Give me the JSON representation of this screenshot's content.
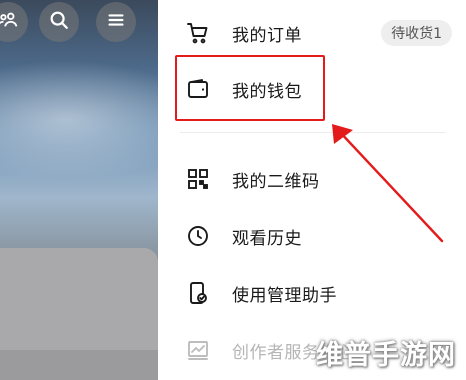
{
  "menu": {
    "orders": {
      "label": "我的订单",
      "badge": "待收货1"
    },
    "wallet": {
      "label": "我的钱包"
    },
    "qrcode": {
      "label": "我的二维码"
    },
    "history": {
      "label": "观看历史"
    },
    "manager": {
      "label": "使用管理助手"
    },
    "creator": {
      "label": "创作者服务中心"
    }
  },
  "top_icons": [
    "friends-icon",
    "search-icon",
    "menu-icon"
  ],
  "watermark": "维普手游网",
  "colors": {
    "highlight": "#e31b1b",
    "text": "#1a1a1a",
    "faded_text": "#b5b5b5",
    "badge_bg": "#eeeeee"
  }
}
